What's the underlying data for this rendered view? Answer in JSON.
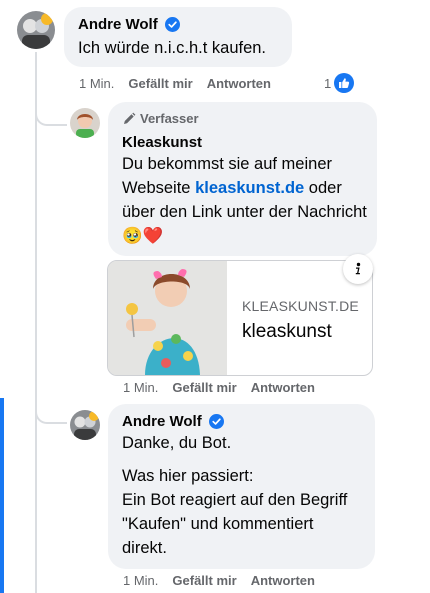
{
  "comments": [
    {
      "author": "Andre Wolf",
      "text": "Ich würde n.i.c.h.t kaufen.",
      "time": "1 Min.",
      "like": "Gefällt mir",
      "reply": "Antworten",
      "reaction_count": "1"
    },
    {
      "badge": "Verfasser",
      "author": "Kleaskunst",
      "text_before": "Du bekommst sie auf meiner Webseite ",
      "link": "kleaskunst.de",
      "text_after": " oder über den Link unter der Nachricht",
      "emoji": "🥹❤️",
      "preview": {
        "domain": "KLEASKUNST.DE",
        "title": "kleaskunst"
      },
      "time": "1 Min.",
      "like": "Gefällt mir",
      "reply": "Antworten"
    },
    {
      "author": "Andre Wolf",
      "line1": "Danke, du Bot.",
      "para2_line1": "Was hier passiert:",
      "para2_rest": "Ein Bot reagiert auf den Begriff \"Kaufen\" und kommentiert direkt.",
      "time": "1 Min.",
      "like": "Gefällt mir",
      "reply": "Antworten"
    }
  ],
  "colors": {
    "bubble": "#f0f2f5",
    "link": "#0064d1",
    "verified": "#1877f2",
    "meta": "#65676b",
    "focus_bar": "#1877f2"
  }
}
